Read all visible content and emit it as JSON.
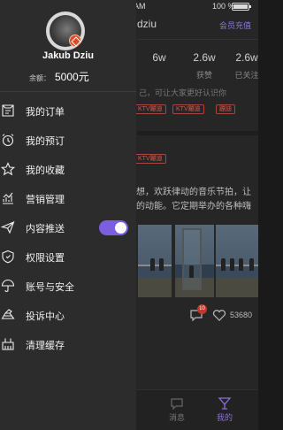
{
  "status_bar": {
    "time": "AM",
    "battery": "100 %",
    "battery_level": 1.0
  },
  "background_page": {
    "name_partial": "dziu",
    "link_text": "会员充值",
    "stats": [
      {
        "value": "6w",
        "label": ""
      },
      {
        "value": "2.6w",
        "label": "获赞"
      },
      {
        "value": "2.6w",
        "label": "已关注"
      }
    ],
    "intro_partial": "己，可让大家更好认识你",
    "tags": [
      "KTV蹦迪",
      "KTV蹦迪",
      "蹦迪",
      "KTV蹦迪"
    ],
    "post_text_line1": "想，欢跃律动的音乐节拍，让",
    "post_text_line2": "的动能。它定期举办的各种嗨",
    "comment_badge": "10",
    "like_count": "53680",
    "tabs": [
      {
        "label": "消息",
        "icon": "message-icon"
      },
      {
        "label": "我的",
        "icon": "cocktail-icon"
      }
    ],
    "accent_color": "#8a6fd6"
  },
  "drawer": {
    "username": "Jakub Dziu",
    "balance_label": "余额：",
    "balance_value": "5000元",
    "menu": [
      {
        "label": "我的订单",
        "icon": "order-icon"
      },
      {
        "label": "我的预订",
        "icon": "alarm-clock-icon"
      },
      {
        "label": "我的收藏",
        "icon": "star-icon"
      },
      {
        "label": "营销管理",
        "icon": "chart-icon"
      },
      {
        "label": "内容推送",
        "icon": "send-icon",
        "toggle_on": true
      },
      {
        "label": "权限设置",
        "icon": "shield-icon"
      },
      {
        "label": "账号与安全",
        "icon": "umbrella-icon"
      },
      {
        "label": "投诉中心",
        "icon": "complaint-icon"
      },
      {
        "label": "清理缓存",
        "icon": "broom-icon"
      }
    ],
    "toggle_color": "#7b5fe0"
  }
}
